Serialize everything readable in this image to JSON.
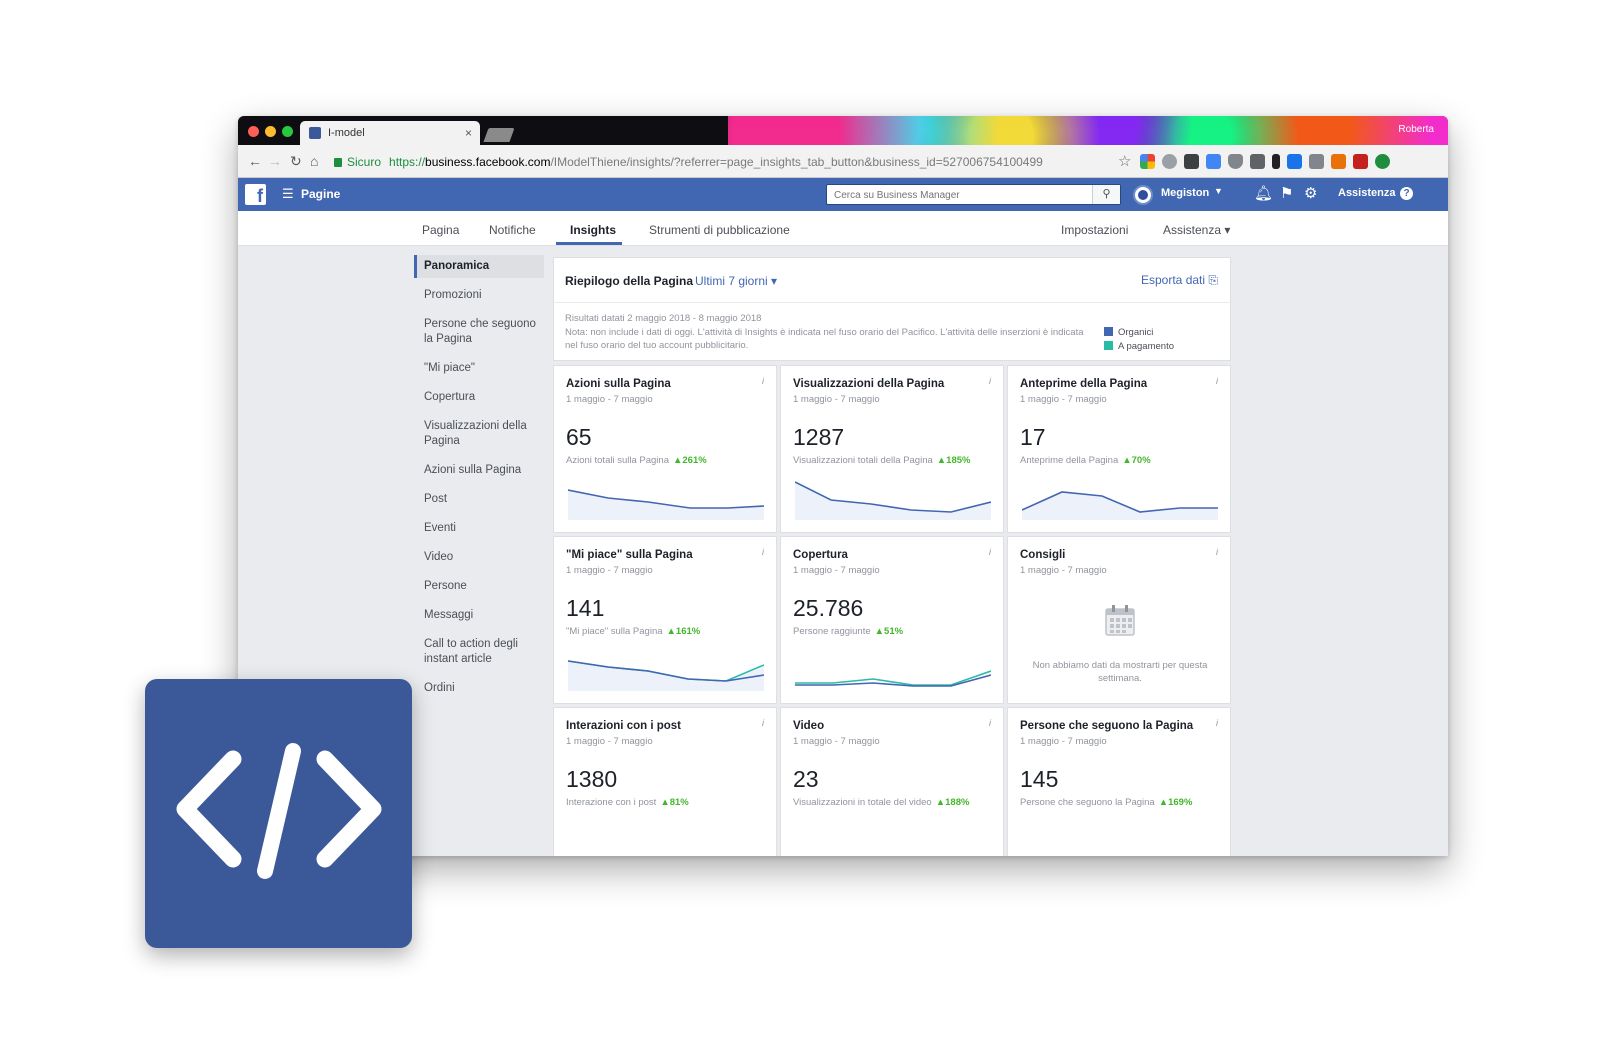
{
  "browser": {
    "tab_title": "I-model",
    "profile_name": "Roberta",
    "secure_label": "Sicuro",
    "url_scheme": "https://",
    "url_host": "business.facebook.com",
    "url_path": "/IModelThiene/insights/?referrer=page_insights_tab_button&business_id=527006754100499"
  },
  "fb_header": {
    "menu_label": "Pagine",
    "search_placeholder": "Cerca su Business Manager",
    "user_name": "Megiston",
    "help_label": "Assistenza"
  },
  "page_nav": {
    "tabs": [
      "Pagina",
      "Notifiche",
      "Insights",
      "Strumenti di pubblicazione"
    ],
    "right": [
      "Impostazioni",
      "Assistenza ▾"
    ]
  },
  "sidebar": {
    "items": [
      "Panoramica",
      "Promozioni",
      "Persone che seguono la Pagina",
      "\"Mi piace\"",
      "Copertura",
      "Visualizzazioni della Pagina",
      "Azioni sulla Pagina",
      "Post",
      "Eventi",
      "Video",
      "Persone",
      "Messaggi",
      "Call to action degli instant article",
      "Ordini"
    ]
  },
  "summary": {
    "title": "Riepilogo della Pagina",
    "range": "Ultimi 7 giorni ▾",
    "export": "Esporta dati",
    "dates": "Risultati datati 2 maggio 2018 - 8 maggio 2018",
    "note": "Nota: non include i dati di oggi. L'attività di Insights è indicata nel fuso orario del Pacifico. L'attività delle inserzioni è indicata nel fuso orario del tuo account pubblicitario.",
    "legend": [
      "Organici",
      "A pagamento"
    ],
    "colors": {
      "organic": "#4267b2",
      "paid": "#2abba7"
    }
  },
  "cards": [
    {
      "title": "Azioni sulla Pagina",
      "range": "1 maggio - 7 maggio",
      "value": "65",
      "sub": "Azioni totali sulla Pagina",
      "delta": "▲261%"
    },
    {
      "title": "Visualizzazioni della Pagina",
      "range": "1 maggio - 7 maggio",
      "value": "1287",
      "sub": "Visualizzazioni totali della Pagina",
      "delta": "▲185%"
    },
    {
      "title": "Anteprime della Pagina",
      "range": "1 maggio - 7 maggio",
      "value": "17",
      "sub": "Anteprime della Pagina",
      "delta": "▲70%"
    },
    {
      "title": "\"Mi piace\" sulla Pagina",
      "range": "1 maggio - 7 maggio",
      "value": "141",
      "sub": "\"Mi piace\" sulla Pagina",
      "delta": "▲161%"
    },
    {
      "title": "Copertura",
      "range": "1 maggio - 7 maggio",
      "value": "25.786",
      "sub": "Persone raggiunte",
      "delta": "▲51%"
    },
    {
      "title": "Consigli",
      "range": "1 maggio - 7 maggio",
      "empty_message": "Non abbiamo dati da mostrarti per questa settimana."
    },
    {
      "title": "Interazioni con i post",
      "range": "1 maggio - 7 maggio",
      "value": "1380",
      "sub": "Interazione con i post",
      "delta": "▲81%"
    },
    {
      "title": "Video",
      "range": "1 maggio - 7 maggio",
      "value": "23",
      "sub": "Visualizzazioni in totale del video",
      "delta": "▲188%"
    },
    {
      "title": "Persone che seguono la Pagina",
      "range": "1 maggio - 7 maggio",
      "value": "145",
      "sub": "Persone che seguono la Pagina",
      "delta": "▲169%"
    }
  ],
  "badge": {
    "icon": "code-icon",
    "color": "#3b5998"
  }
}
